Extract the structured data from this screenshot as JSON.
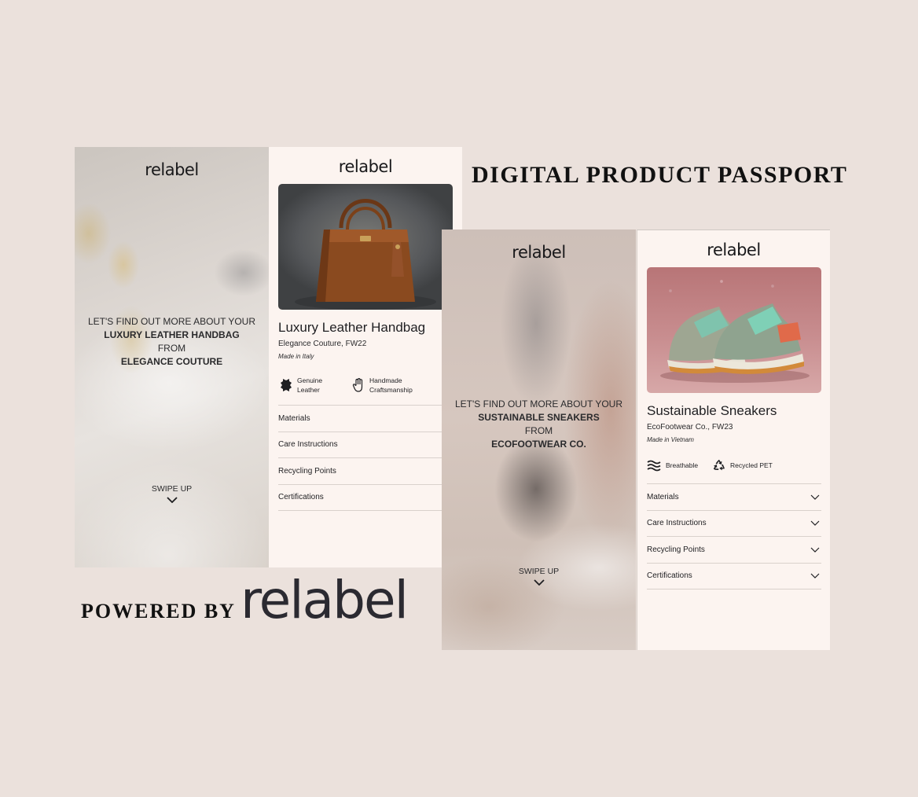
{
  "headline": "DIGITAL PRODUCT PASSPORT",
  "footer": {
    "powered_label": "POWERED BY",
    "brand": "relabel"
  },
  "brand_logo": "relabel",
  "colors": {
    "background": "#ebe1dc",
    "card": "#fcf4f0",
    "text": "#1f1f22",
    "logo": "#2b2a31"
  },
  "bag": {
    "splash": {
      "intro": "LET'S FIND OUT MORE ABOUT YOUR",
      "product": "LUXURY LEATHER HANDBAG",
      "from": "FROM",
      "maker": "ELEGANCE COUTURE",
      "swipe": "SWIPE UP"
    },
    "card": {
      "title": "Luxury Leather Handbag",
      "subtitle": "Elegance Couture, FW22",
      "made_in": "Made in Italy",
      "features": [
        {
          "icon": "leather-hide-icon",
          "line1": "Genuine",
          "line2": "Leather"
        },
        {
          "icon": "hand-icon",
          "line1": "Handmade",
          "line2": "Craftsmanship"
        }
      ],
      "menu": [
        "Materials",
        "Care Instructions",
        "Recycling Points",
        "Certifications"
      ]
    }
  },
  "shoe": {
    "splash": {
      "intro": "LET'S FIND OUT MORE ABOUT YOUR",
      "product": "SUSTAINABLE SNEAKERS",
      "from": "FROM",
      "maker": "ECOFOOTWEAR CO.",
      "swipe": "SWIPE UP"
    },
    "card": {
      "title": "Sustainable Sneakers",
      "subtitle": "EcoFootwear Co., FW23",
      "made_in": "Made in Vietnam",
      "features": [
        {
          "icon": "waves-icon",
          "label": "Breathable"
        },
        {
          "icon": "recycle-icon",
          "label": "Recycled PET"
        }
      ],
      "menu": [
        "Materials",
        "Care Instructions",
        "Recycling Points",
        "Certifications"
      ]
    }
  }
}
